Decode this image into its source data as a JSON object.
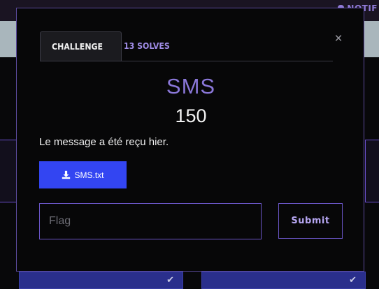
{
  "background": {
    "nav_link": "NOTIF",
    "solved_check": "✔"
  },
  "modal": {
    "tabs": [
      {
        "label": "CHALLENGE",
        "active": true
      },
      {
        "label": "13 SOLVES",
        "active": false
      }
    ],
    "close_label": "×",
    "challenge_name": "SMS",
    "points": "150",
    "description": "Le message a été reçu hier.",
    "file": {
      "label": "SMS.txt",
      "icon": "download-icon"
    },
    "flag_input": {
      "placeholder": "Flag",
      "value": ""
    },
    "submit_label": "Submit"
  },
  "colors": {
    "accent": "#8a77d8",
    "file_button": "#3345f2",
    "border": "#6a55c6",
    "background": "#070708"
  }
}
